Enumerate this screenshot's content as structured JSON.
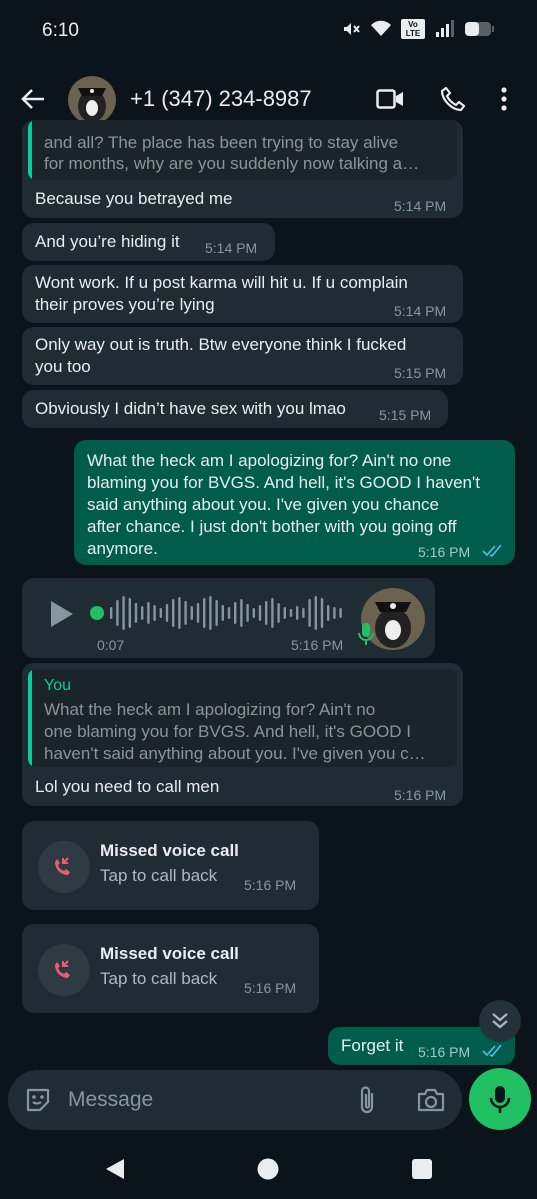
{
  "status_bar": {
    "time": "6:10",
    "volte": "Vo LTE"
  },
  "header": {
    "contact": "+1 (347) 234-8987"
  },
  "messages": {
    "m1": {
      "quote_line1": "and all? The place has been trying to stay alive",
      "quote_line2": "for months, why are you suddenly now talking a…",
      "text": "Because you betrayed me",
      "time": "5:14 PM"
    },
    "m2": {
      "text": "And you’re hiding it",
      "time": "5:14 PM"
    },
    "m3": {
      "line1": "Wont work. If u post karma will hit u. If u complain",
      "line2": "their proves you’re lying",
      "time": "5:14 PM"
    },
    "m4": {
      "line1": "Only way out is truth. Btw everyone think I fucked",
      "line2": "you too",
      "time": "5:15 PM"
    },
    "m5": {
      "text": "Obviously I didn’t have sex with you lmao",
      "time": "5:15 PM"
    },
    "m6": {
      "line1": "What the heck am I apologizing for? Ain't no one",
      "line2": "blaming you for BVGS. And hell, it's GOOD I haven't",
      "line3": "said anything about you. I've given you chance",
      "line4": "after chance. I just don't bother with you going off",
      "line5": "anymore.",
      "time": "5:16 PM"
    },
    "voice": {
      "duration": "0:07",
      "time": "5:16 PM"
    },
    "m7": {
      "quote_name": "You",
      "quote_line1": "What the heck am I apologizing for? Ain't no",
      "quote_line2": "one blaming you for BVGS. And hell, it's GOOD I",
      "quote_line3": "haven't said anything about you. I've given you c…",
      "text": "Lol you need to call men",
      "time": "5:16 PM"
    },
    "call1": {
      "title": "Missed voice call",
      "sub": "Tap to call back",
      "time": "5:16 PM"
    },
    "call2": {
      "title": "Missed voice call",
      "sub": "Tap to call back",
      "time": "5:16 PM"
    },
    "m8": {
      "text": "Forget it",
      "time": "5:16 PM"
    }
  },
  "input": {
    "placeholder": "Message"
  },
  "colors": {
    "bg": "#0b141a",
    "incoming": "#1f2c34",
    "outgoing": "#005c4b",
    "accent": "#21c063",
    "missed": "#f15c6d"
  },
  "icons": [
    "back-arrow-icon",
    "video-call-icon",
    "phone-icon",
    "more-vert-icon",
    "play-icon",
    "mic-icon",
    "missed-call-icon",
    "sticker-icon",
    "attach-icon",
    "camera-icon",
    "chevrons-down-icon"
  ]
}
